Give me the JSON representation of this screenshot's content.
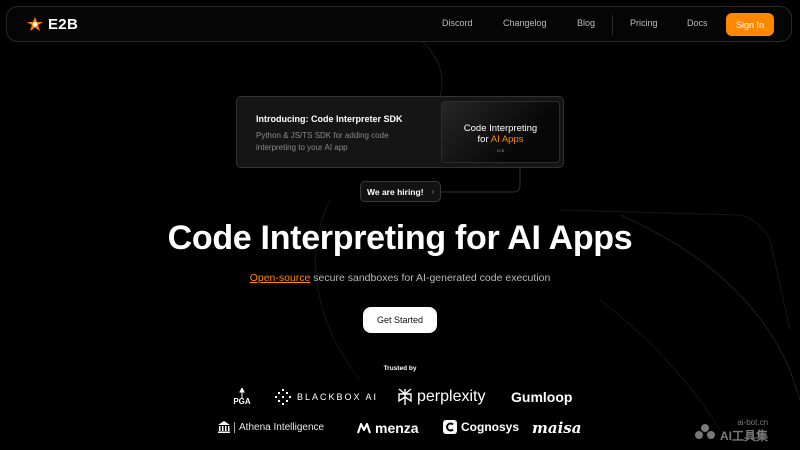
{
  "colors": {
    "accent": "#ff8800",
    "background": "#000000",
    "text": "#ffffff"
  },
  "nav": {
    "brand": "E2B",
    "links": [
      "Discord",
      "Changelog",
      "Blog",
      "Pricing",
      "Docs"
    ],
    "signin": "Sign In"
  },
  "promo": {
    "title": "Introducing: Code Interpreter SDK",
    "description": "Python & JS/TS SDK for adding code interpreting to your AI app",
    "thumb_line1": "Code Interpreting",
    "thumb_line2_a": "for",
    "thumb_line2_b": "AI Apps",
    "thumb_badge": "E2B"
  },
  "hiring": {
    "label": "We are hiring!",
    "icon": "chevron-right-icon"
  },
  "hero": {
    "title": "Code Interpreting for AI Apps",
    "subtitle_link": "Open-source",
    "subtitle_rest": " secure sandboxes for AI-generated code execution",
    "cta": "Get Started"
  },
  "trusted": {
    "label": "Trusted by",
    "logos": {
      "pga": "PGA",
      "blackbox": "BLACKBOX AI",
      "perplexity": "perplexity",
      "gumloop": "Gumloop",
      "athena": "Athena Intelligence",
      "menza": "menza",
      "cognosys": "Cognosys",
      "maisa": "maisa"
    }
  },
  "watermark": {
    "top": "ai-bot.cn",
    "bottom": "AI工具集"
  }
}
